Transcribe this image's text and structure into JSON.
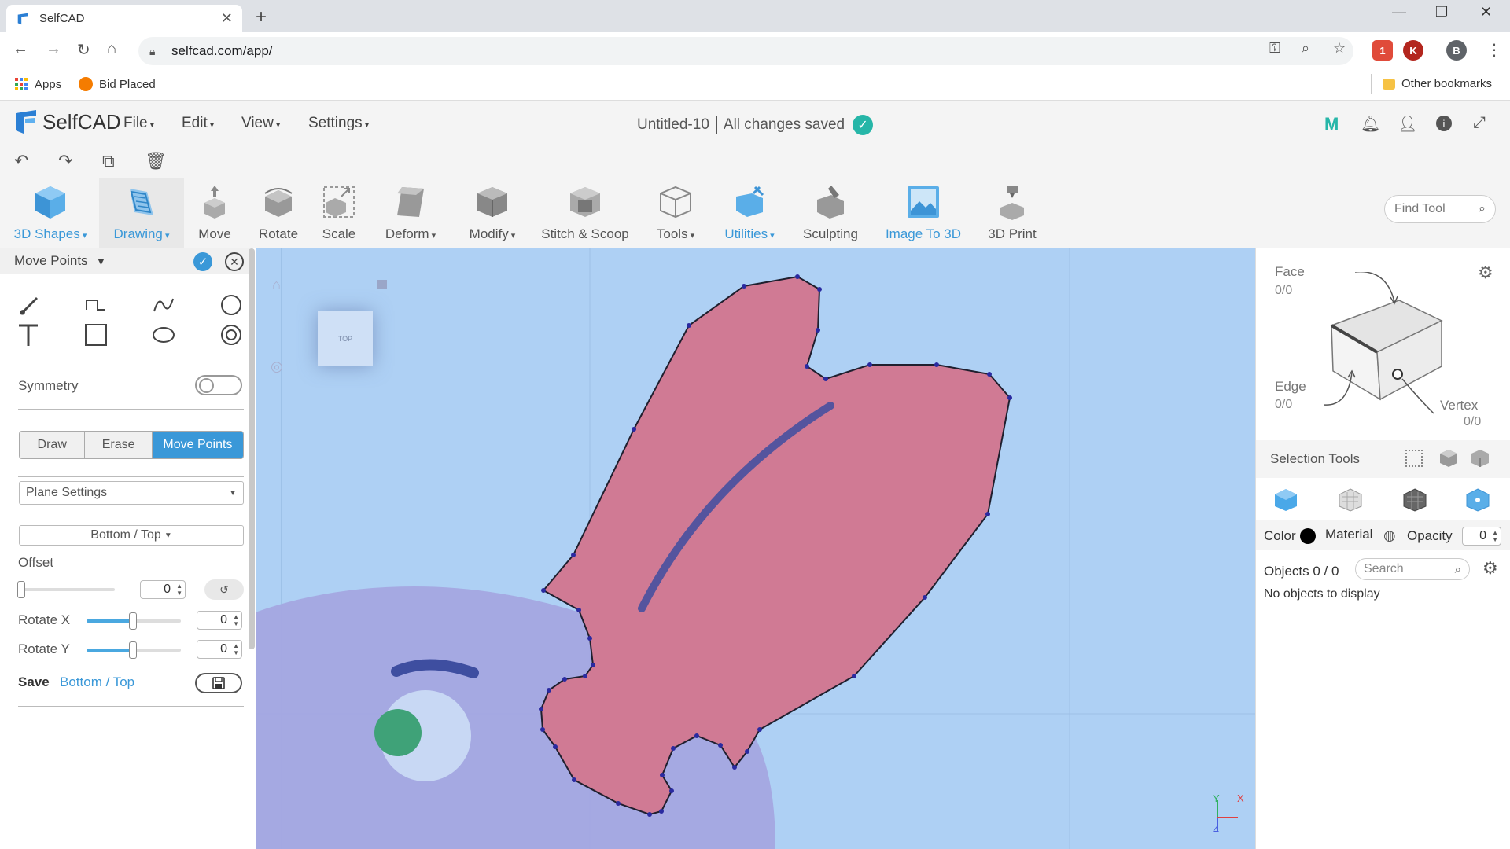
{
  "browser": {
    "tab_title": "SelfCAD",
    "url": "selfcad.com/app/",
    "bookmarks": {
      "apps": "Apps",
      "bid_placed": "Bid Placed",
      "other": "Other bookmarks"
    },
    "profile_letter": "B",
    "ext_letter": "K",
    "ext_badge": "1"
  },
  "app": {
    "logo_text": "SelfCAD",
    "menus": [
      "File",
      "Edit",
      "View",
      "Settings"
    ],
    "doc_title": "Untitled-10",
    "save_status": "All changes saved",
    "brand_m": "M"
  },
  "toolbar": {
    "tools": [
      "3D Shapes",
      "Drawing",
      "Move",
      "Rotate",
      "Scale",
      "Deform",
      "Modify",
      "Stitch & Scoop",
      "Tools",
      "Utilities",
      "Sculpting",
      "Image To 3D",
      "3D Print"
    ],
    "find_placeholder": "Find Tool"
  },
  "left_panel": {
    "title": "Move Points",
    "symmetry_label": "Symmetry",
    "modes": [
      "Draw",
      "Erase",
      "Move Points"
    ],
    "active_mode": "Move Points",
    "plane_settings": "Plane Settings",
    "plane": "Bottom / Top",
    "offset_label": "Offset",
    "offset_value": "0",
    "rotate_x_label": "Rotate X",
    "rotate_x_value": "0",
    "rotate_y_label": "Rotate Y",
    "rotate_y_value": "0",
    "save_label": "Save",
    "save_plane": "Bottom / Top"
  },
  "viewport": {
    "viewcube_label": "TOP",
    "axis_y": "Y",
    "axis_x": "X",
    "axis_z": "Z"
  },
  "right_panel": {
    "face_label": "Face",
    "face_count": "0/0",
    "edge_label": "Edge",
    "edge_count": "0/0",
    "vertex_label": "Vertex",
    "vertex_count": "0/0",
    "selection_tools": "Selection Tools",
    "color_label": "Color",
    "material_label": "Material",
    "opacity_label": "Opacity",
    "opacity_value": "0",
    "objects_label": "Objects 0 / 0",
    "search_placeholder": "Search",
    "empty_message": "No objects to display"
  },
  "colors": {
    "accent": "#3a98d8",
    "viewport_bg": "#aed0f4",
    "shape_fill": "#d07a94",
    "check_green": "#26b6a8"
  }
}
